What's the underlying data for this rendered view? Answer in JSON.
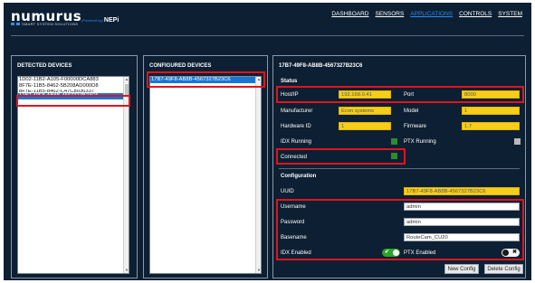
{
  "brand": {
    "name": "numurus",
    "tagline": "SMART SYSTEM SOLUTIONS",
    "powered_prefix": "(Powered by)",
    "powered_name": "NEPi"
  },
  "nav": {
    "items": [
      {
        "label": "DASHBOARD"
      },
      {
        "label": "SENSORS"
      },
      {
        "label": "APPLICATIONS"
      },
      {
        "label": "CONTROLS"
      },
      {
        "label": "SYSTEM"
      }
    ],
    "active": "APPLICATIONS"
  },
  "detected": {
    "title": "DETECTED DEVICES",
    "items": [
      "1D02-11B2-A105-F00000DCA883",
      "8F7E-11B5-8462-5B208AD000D8",
      "8F7E-11B5-8462-C47C8036337",
      "17B7-49F8-AB8B-4567327B23C6"
    ],
    "selected": "17B7-49F8-AB8B-4567327B23C6"
  },
  "configured": {
    "title": "CONFIGURED DEVICES",
    "items": [
      "17B7-49F8-AB8B-4567327B23C6"
    ],
    "selected": "17B7-49F8-AB8B-4567327B23C6"
  },
  "details": {
    "device_id": "17B7-49F8-AB8B-4567327B23C6",
    "status_heading": "Status",
    "host_label": "Host/IP",
    "host_value": "192.168.0.41",
    "port_label": "Port",
    "port_value": "8000",
    "manufacturer_label": "Manufacturer",
    "manufacturer_value": "Econ systems",
    "model_label": "Model",
    "model_value": "1",
    "hardware_label": "Hardware ID",
    "hardware_value": "1",
    "firmware_label": "Firmware",
    "firmware_value": "1.7",
    "idx_running_label": "IDX Running",
    "idx_running": true,
    "ptx_running_label": "PTX Running",
    "ptx_running": false,
    "connected_label": "Connected",
    "connected": true,
    "configuration_heading": "Configuration",
    "uuid_label": "UUID",
    "uuid_value": "17B7-49F8-AB8B-4567327B23C6",
    "username_label": "Username",
    "username_value": "admin",
    "password_label": "Password",
    "password_value": "admin",
    "basename_label": "Basename",
    "basename_value": "RouteCam_CU20",
    "idx_enabled_label": "IDX Enabled",
    "idx_enabled": true,
    "ptx_enabled_label": "PTX Enabled",
    "ptx_enabled": false,
    "toggle_on_mark": "✔",
    "toggle_off_mark": "✖",
    "new_config_label": "New Config",
    "delete_config_label": "Delete Config"
  },
  "colors": {
    "background": "#0c1f33",
    "accent": "#2d8cf0",
    "selection": "#1877d4",
    "readonly_field": "#f6ce1a",
    "status_on": "#2e8b2e",
    "status_off": "#b8b8b8",
    "highlight": "#e0141e"
  }
}
